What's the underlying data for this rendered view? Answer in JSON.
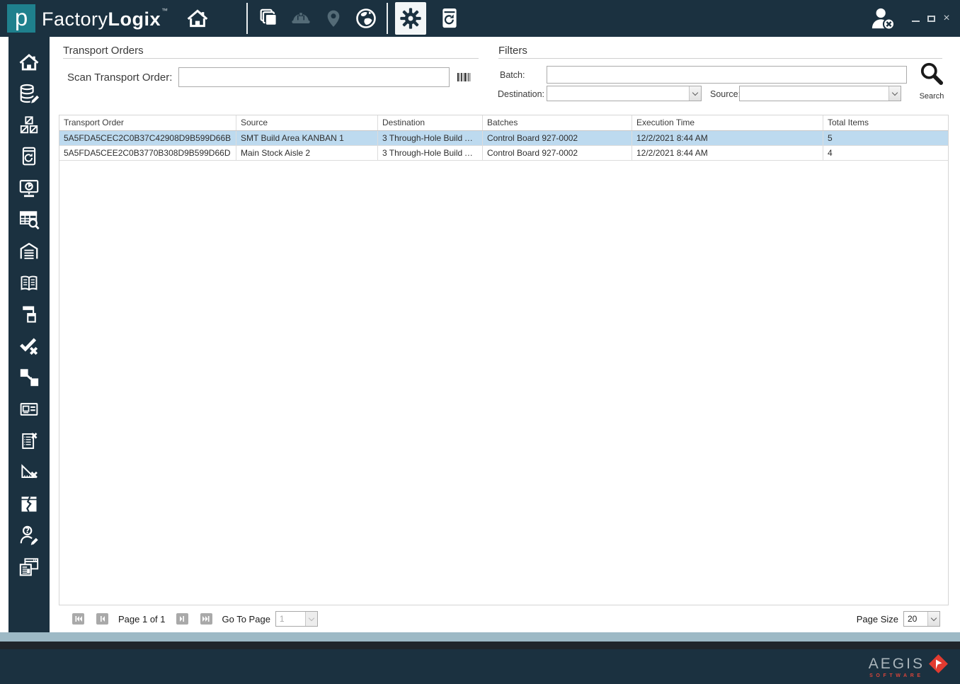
{
  "titlebar": {
    "brand_factory": "Factory",
    "brand_logix": "Logix",
    "brand_tm": "™",
    "close_glyph": "×"
  },
  "panel": {
    "transport_orders_title": "Transport Orders",
    "scan_label": "Scan Transport Order:",
    "scan_value": "",
    "filters_title": "Filters",
    "batch_label": "Batch:",
    "batch_value": "",
    "destination_label": "Destination:",
    "destination_value": "",
    "source_label": "Source:",
    "source_value": "",
    "search_label": "Search"
  },
  "table": {
    "columns": [
      "Transport Order",
      "Source",
      "Destination",
      "Batches",
      "Execution Time",
      "Total Items"
    ],
    "rows": [
      {
        "transport_order": "5A5FDA5CEC2C0B37C42908D9B599D66B",
        "source": "SMT Build Area KANBAN 1",
        "destination": "3 Through-Hole Build Ar...",
        "batches": "Control Board 927-0002",
        "execution_time": "12/2/2021 8:44 AM",
        "total_items": "5"
      },
      {
        "transport_order": "5A5FDA5CEE2C0B3770B308D9B599D66D",
        "source": "Main Stock Aisle 2",
        "destination": "3 Through-Hole Build Ar...",
        "batches": "Control Board 927-0002",
        "execution_time": "12/2/2021 8:44 AM",
        "total_items": "4"
      }
    ]
  },
  "pager": {
    "page_text": "Page 1 of 1",
    "goto_label": "Go To Page",
    "goto_value": "1",
    "page_size_label": "Page Size",
    "page_size_value": "20"
  },
  "footer": {
    "brand": "AEGIS",
    "subtitle": "SOFTWARE"
  },
  "colors": {
    "titlebar": "#1B3140",
    "logo_teal": "#1F808D",
    "selected_row": "#BDDAEF",
    "disabled_icon": "#546B77",
    "aegis_red": "#E23B30",
    "scroll_bar": "#9DB9C5"
  }
}
